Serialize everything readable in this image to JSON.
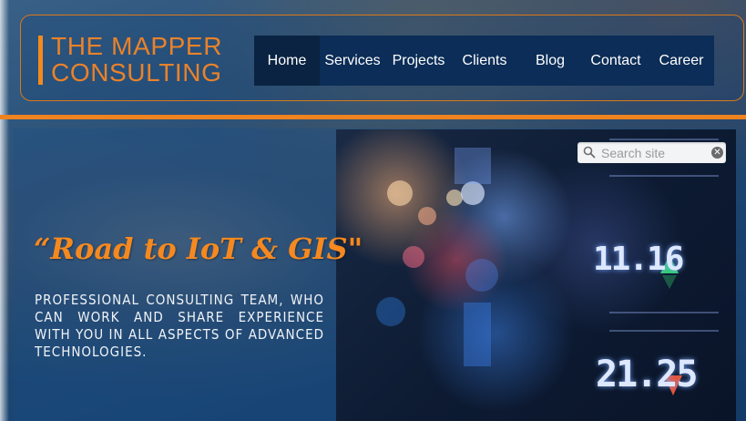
{
  "brand": {
    "line1": "THE MAPPER",
    "line2": "CONSULTING",
    "color": "#e9822a"
  },
  "nav": {
    "items": [
      {
        "label": "Home",
        "active": true
      },
      {
        "label": "Services"
      },
      {
        "label": "Projects"
      },
      {
        "label": "Clients"
      },
      {
        "label": "Blog"
      },
      {
        "label": "Contact"
      },
      {
        "label": "Career"
      }
    ]
  },
  "search": {
    "placeholder": "Search site",
    "icon": "magnifier-icon",
    "clear_icon": "clear-icon",
    "clear_glyph": "✕"
  },
  "hero": {
    "tagline": "“Road to  IoT & GIS\"",
    "description": "PROFESSIONAL CONSULTING TEAM, WHO CAN WORK AND SHARE EXPERIENCE WITH YOU IN ALL ASPECTS OF ADVANCED TECHNOLOGIES.",
    "photo_numbers": [
      "11.16",
      "21.25"
    ]
  },
  "colors": {
    "accent": "#ee8320",
    "nav_bg": "#0b2d57",
    "nav_active_bg": "#0a2342"
  }
}
